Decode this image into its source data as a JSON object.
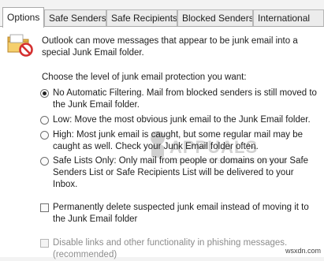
{
  "tabs": [
    {
      "label": "Options",
      "active": true
    },
    {
      "label": "Safe Senders",
      "active": false
    },
    {
      "label": "Safe Recipients",
      "active": false
    },
    {
      "label": "Blocked Senders",
      "active": false
    },
    {
      "label": "International",
      "active": false
    }
  ],
  "intro_text": "Outlook can move messages that appear to be junk email into a special Junk Email folder.",
  "prompt_text": "Choose the level of junk email protection you want:",
  "levels": {
    "selected": "no_filtering",
    "no_filtering": "No Automatic Filtering. Mail from blocked senders is still moved to the Junk Email folder.",
    "low": "Low: Move the most obvious junk email to the Junk Email folder.",
    "high": "High: Most junk email is caught, but some regular mail may be caught as well. Check your Junk Email folder often.",
    "safe_lists": "Safe Lists Only: Only mail from people or domains on your Safe Senders List or Safe Recipients List will be delivered to your Inbox."
  },
  "permanently_delete": {
    "label": "Permanently delete suspected junk email instead of moving it to the Junk Email folder",
    "checked": false
  },
  "disable_links": {
    "label": "Disable links and other functionality in phishing messages. (recommended)",
    "checked": false,
    "enabled": false
  },
  "watermark": {
    "text": "APPUALS",
    "subtext": "TECH HOW-TO'S FROM THE EXPERTS"
  },
  "credit": "wsxdn.com",
  "colors": {
    "dialog_bg": "#f3f3f3",
    "panel_bg": "#ffffff",
    "folder": "#f2c55c",
    "no_sign": "#d42f2f"
  },
  "icons": {
    "header": "junk-folder-icon"
  }
}
